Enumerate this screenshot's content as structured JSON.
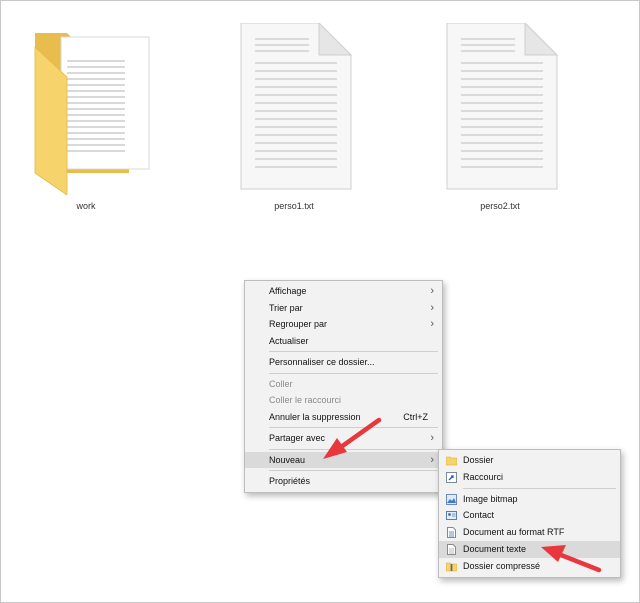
{
  "files": [
    {
      "name": "work",
      "type": "folder"
    },
    {
      "name": "perso1.txt",
      "type": "text-file"
    },
    {
      "name": "perso2.txt",
      "type": "text-file"
    }
  ],
  "context_menu": {
    "affichage": "Affichage",
    "trier_par": "Trier par",
    "regrouper_par": "Regrouper par",
    "actualiser": "Actualiser",
    "personnaliser": "Personnaliser ce dossier...",
    "coller": "Coller",
    "coller_raccourci": "Coller le raccourci",
    "annuler_suppression": "Annuler la suppression",
    "annuler_shortcut": "Ctrl+Z",
    "partager_avec": "Partager avec",
    "nouveau": "Nouveau",
    "proprietes": "Propriétés"
  },
  "submenu": {
    "dossier": "Dossier",
    "raccourci": "Raccourci",
    "image_bitmap": "Image bitmap",
    "contact": "Contact",
    "document_rtf": "Document au format RTF",
    "document_texte": "Document texte",
    "dossier_compresse": "Dossier compressé"
  },
  "icons": {
    "folder": "folder-icon",
    "shortcut": "shortcut-icon",
    "bitmap": "bitmap-icon",
    "contact": "contact-card-icon",
    "rtf": "rtf-document-icon",
    "text": "text-document-icon",
    "zip": "zip-folder-icon",
    "chevron": "chevron-right-icon",
    "annotation": "red-arrow-annotation"
  },
  "colors": {
    "menu_bg": "#f2f2f2",
    "highlight": "#dadada",
    "disabled_text": "#8a8a8a",
    "folder_yellow": "#f7d46b",
    "annotation_red": "#e8383d"
  }
}
